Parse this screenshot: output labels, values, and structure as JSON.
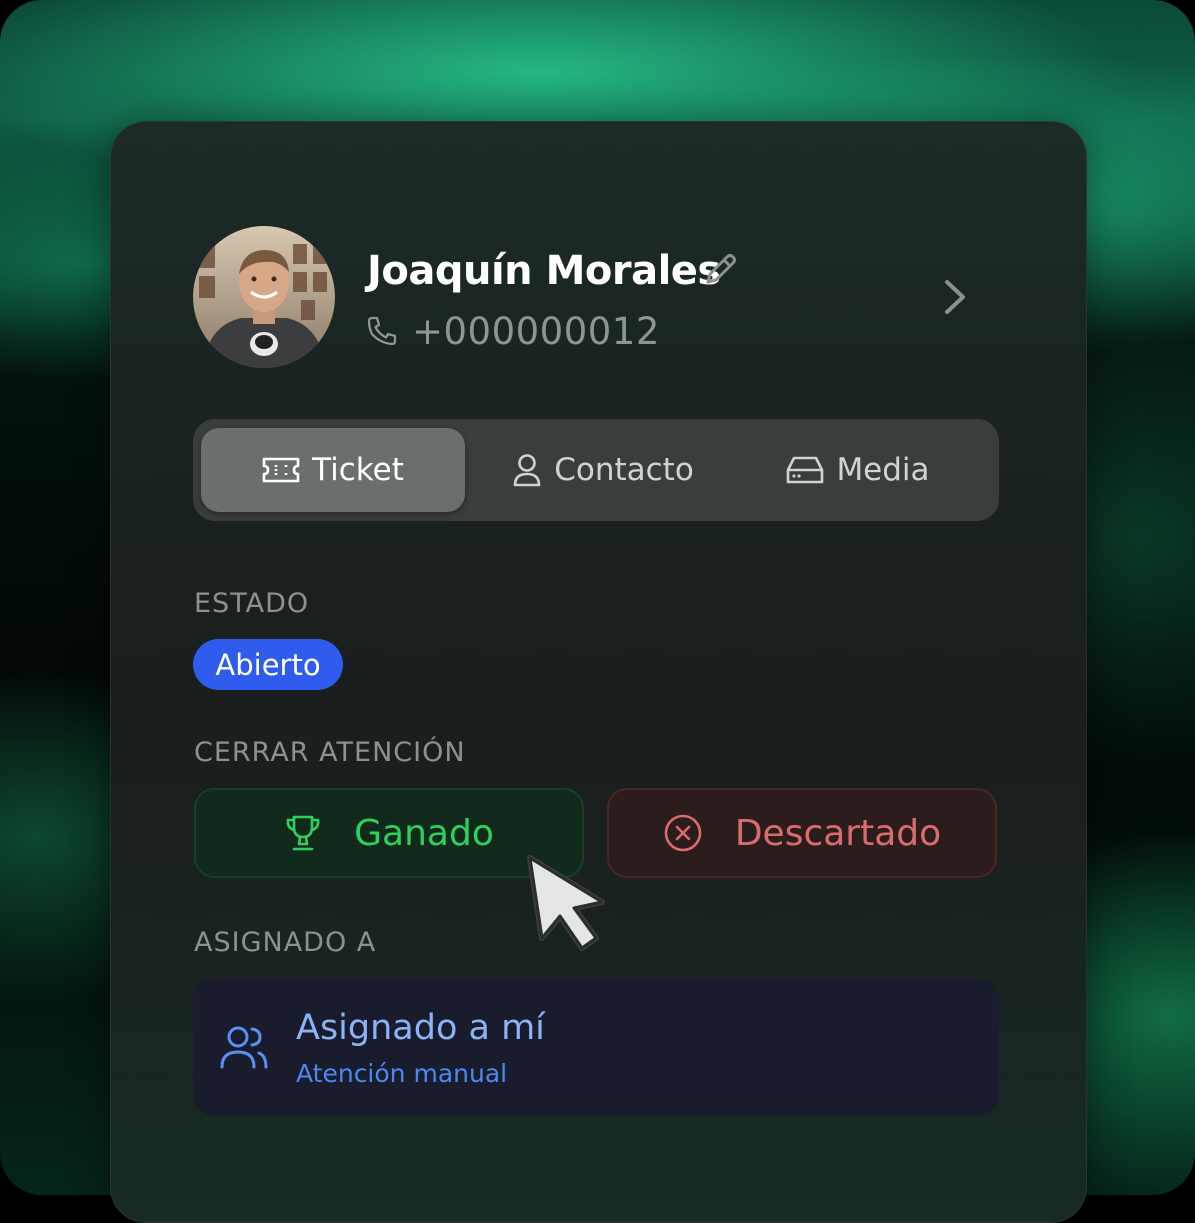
{
  "contact": {
    "name": "Joaquín Morales",
    "phone": "+000000012"
  },
  "tabs": [
    {
      "label": "Ticket",
      "icon": "ticket-icon",
      "active": true
    },
    {
      "label": "Contacto",
      "icon": "user-icon",
      "active": false
    },
    {
      "label": "Media",
      "icon": "hard-drive-icon",
      "active": false
    }
  ],
  "status": {
    "label": "ESTADO",
    "value": "Abierto",
    "color": "#2f5cec"
  },
  "close": {
    "label": "CERRAR ATENCIÓN",
    "won": "Ganado",
    "lost": "Descartado",
    "won_color": "#2ed15f",
    "lost_color": "#d96d6d"
  },
  "assigned": {
    "label": "ASIGNADO A",
    "title": "Asignado a mí",
    "subtitle": "Atención manual"
  }
}
